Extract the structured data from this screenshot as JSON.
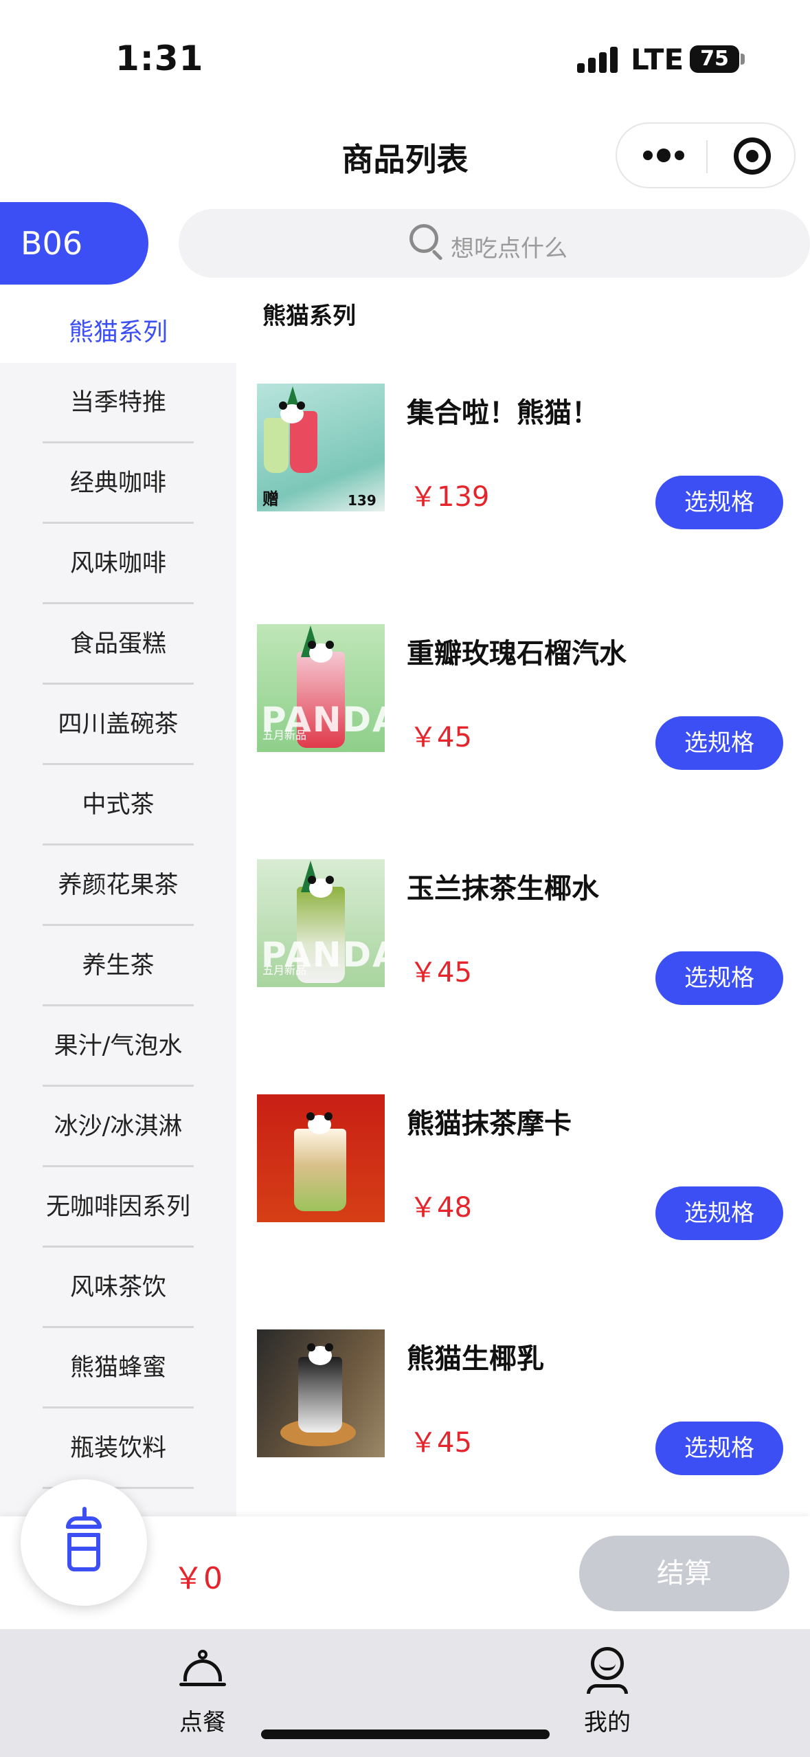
{
  "status_bar": {
    "time": "1:31",
    "network": "LTE",
    "battery": "75"
  },
  "header": {
    "title": "商品列表"
  },
  "table": {
    "label": "B06"
  },
  "search": {
    "placeholder": "想吃点什么"
  },
  "sidebar": {
    "active": "熊猫系列",
    "items": [
      {
        "label": "当季特推"
      },
      {
        "label": "经典咖啡"
      },
      {
        "label": "风味咖啡"
      },
      {
        "label": "食品蛋糕"
      },
      {
        "label": "四川盖碗茶"
      },
      {
        "label": "中式茶"
      },
      {
        "label": "养颜花果茶"
      },
      {
        "label": "养生茶"
      },
      {
        "label": "果汁/气泡水"
      },
      {
        "label": "冰沙/冰淇淋"
      },
      {
        "label": "无咖啡因系列"
      },
      {
        "label": "风味茶饮"
      },
      {
        "label": "熊猫蜂蜜"
      },
      {
        "label": "瓶装饮料"
      }
    ]
  },
  "section": {
    "title": "熊猫系列"
  },
  "products": [
    {
      "name": "集合啦！熊猫！",
      "price": "￥139",
      "button": "选规格",
      "image_text": "赠",
      "image_price": "139",
      "image_color": "#7cc7b8"
    },
    {
      "name": "重瓣玫瑰石榴汽水",
      "price": "￥45",
      "button": "选规格",
      "image_text": "PANDA",
      "image_sub": "五月新品",
      "image_color": "#8ecf8a"
    },
    {
      "name": "玉兰抹茶生椰水",
      "price": "￥45",
      "button": "选规格",
      "image_text": "PANDA",
      "image_sub": "五月新品",
      "image_color": "#a8d49e"
    },
    {
      "name": "熊猫抹茶摩卡",
      "price": "￥48",
      "button": "选规格",
      "image_color": "#c81f15"
    },
    {
      "name": "熊猫生椰乳",
      "price": "￥45",
      "button": "选规格",
      "image_color": "#6e5a40"
    }
  ],
  "cart": {
    "total": "￥0",
    "checkout": "结算",
    "icon": "cup-icon"
  },
  "tabs": [
    {
      "label": "点餐",
      "icon": "dish-icon"
    },
    {
      "label": "我的",
      "icon": "user-icon"
    }
  ],
  "colors": {
    "accent": "#3b4ff5",
    "price": "#e5242b",
    "disabled": "#c9cbd3"
  }
}
